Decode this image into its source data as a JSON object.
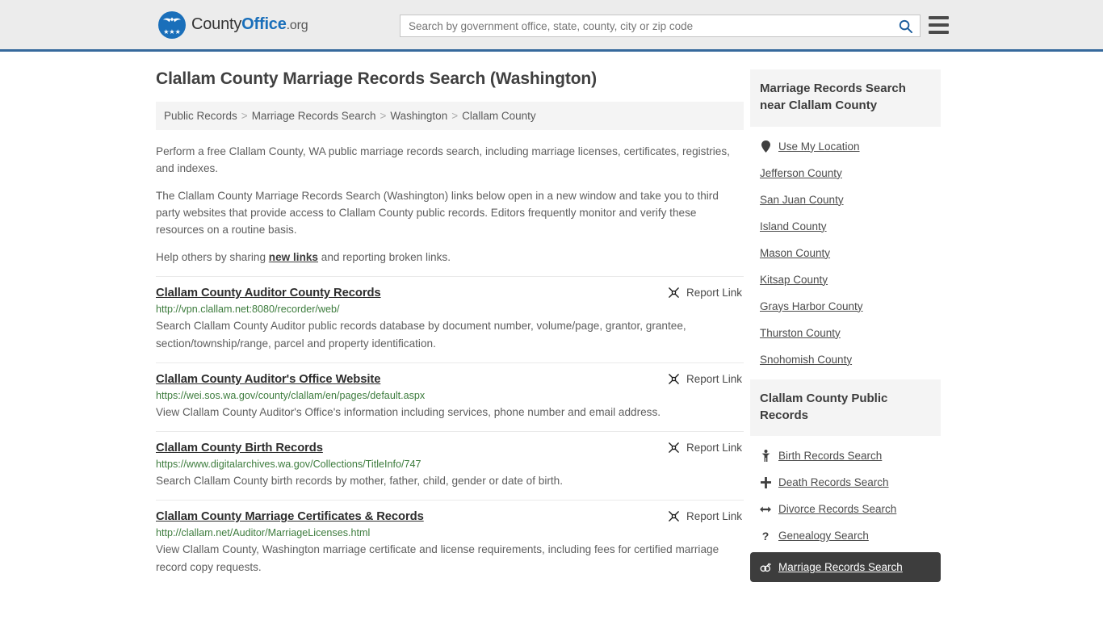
{
  "header": {
    "logo": {
      "text_part1": "County",
      "text_part2": "Office",
      "text_part3": ".org",
      "icon": "eagle-seal-icon",
      "stars": "★★★"
    },
    "search": {
      "placeholder": "Search by government office, state, county, city or zip code",
      "value": "",
      "icon": "search-icon"
    },
    "menu_icon": "hamburger-menu-icon",
    "background_color": "#ececec",
    "accent_color": "#36699c"
  },
  "main": {
    "title": "Clallam County Marriage Records Search (Washington)",
    "breadcrumb": [
      "Public Records",
      "Marriage Records Search",
      "Washington",
      "Clallam County"
    ],
    "breadcrumb_separator": ">",
    "intro_1": "Perform a free Clallam County, WA public marriage records search, including marriage licenses, certificates, registries, and indexes.",
    "intro_2": "The Clallam County Marriage Records Search (Washington) links below open in a new window and take you to third party websites that provide access to Clallam County public records. Editors frequently monitor and verify these resources on a routine basis.",
    "help_prefix": "Help others by sharing ",
    "help_link": "new links",
    "help_suffix": " and reporting broken links.",
    "report_link_label": "Report Link",
    "report_link_icon": "unlink-icon",
    "results": [
      {
        "title": "Clallam County Auditor County Records",
        "url": "http://vpn.clallam.net:8080/recorder/web/",
        "description": "Search Clallam County Auditor public records database by document number, volume/page, grantor, grantee, section/township/range, parcel and property identification."
      },
      {
        "title": "Clallam County Auditor's Office Website",
        "url": "https://wei.sos.wa.gov/county/clallam/en/pages/default.aspx",
        "description": "View Clallam County Auditor's Office's information including services, phone number and email address."
      },
      {
        "title": "Clallam County Birth Records",
        "url": "https://www.digitalarchives.wa.gov/Collections/TitleInfo/747",
        "description": "Search Clallam County birth records by mother, father, child, gender or date of birth."
      },
      {
        "title": "Clallam County Marriage Certificates & Records",
        "url": "http://clallam.net/Auditor/MarriageLicenses.html",
        "description": "View Clallam County, Washington marriage certificate and license requirements, including fees for certified marriage record copy requests."
      }
    ]
  },
  "sidebar": {
    "nearby": {
      "heading": "Marriage Records Search near Clallam County",
      "items": [
        {
          "label": "Use My Location",
          "icon": "location-pin-icon"
        },
        {
          "label": "Jefferson County",
          "icon": ""
        },
        {
          "label": "San Juan County",
          "icon": ""
        },
        {
          "label": "Island County",
          "icon": ""
        },
        {
          "label": "Mason County",
          "icon": ""
        },
        {
          "label": "Kitsap County",
          "icon": ""
        },
        {
          "label": "Grays Harbor County",
          "icon": ""
        },
        {
          "label": "Thurston County",
          "icon": ""
        },
        {
          "label": "Snohomish County",
          "icon": ""
        }
      ]
    },
    "public_records": {
      "heading": "Clallam County Public Records",
      "items": [
        {
          "label": "Birth Records Search",
          "icon": "baby-icon",
          "active": false
        },
        {
          "label": "Death Records Search",
          "icon": "cross-icon",
          "active": false
        },
        {
          "label": "Divorce Records Search",
          "icon": "left-right-arrow-icon",
          "active": false
        },
        {
          "label": "Genealogy Search",
          "icon": "question-mark-icon",
          "active": false
        },
        {
          "label": "Marriage Records Search",
          "icon": "rings-icon",
          "active": true
        }
      ]
    }
  }
}
